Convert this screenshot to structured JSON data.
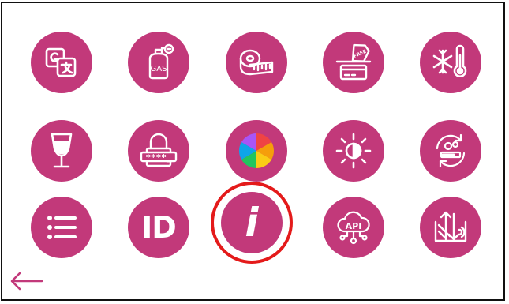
{
  "colors": {
    "tile_background": "#c2397a",
    "icon_foreground": "#ffffff",
    "highlight_ring": "#e41a1a",
    "back_arrow": "#c2397a"
  },
  "tiles": [
    {
      "icon": "translate-icon"
    },
    {
      "icon": "gas-cylinder-icon",
      "label": "GAS"
    },
    {
      "icon": "measuring-tape-icon"
    },
    {
      "icon": "free-card-payment-icon",
      "label": "FREE"
    },
    {
      "icon": "snowflake-thermometer-icon"
    },
    {
      "icon": "wine-glass-icon"
    },
    {
      "icon": "password-lock-icon",
      "label": "****_"
    },
    {
      "icon": "color-wheel-icon"
    },
    {
      "icon": "brightness-contrast-icon"
    },
    {
      "icon": "settings-update-icon"
    },
    {
      "icon": "list-icon"
    },
    {
      "icon": "id-icon",
      "label": "ID"
    },
    {
      "icon": "info-icon",
      "label": "i",
      "highlighted": true
    },
    {
      "icon": "api-cloud-icon",
      "label": "API"
    },
    {
      "icon": "data-transfer-icon"
    }
  ],
  "back": {
    "icon": "back-arrow-icon"
  }
}
